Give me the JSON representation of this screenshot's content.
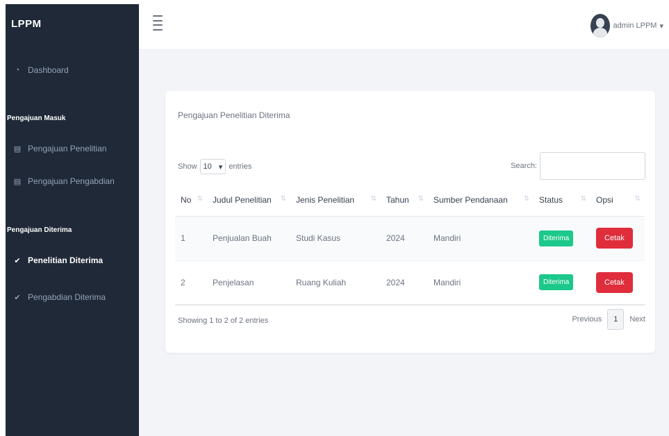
{
  "sidebar": {
    "brand": "LPPM",
    "dashboard": "Dashboard",
    "heading_masuk": "Pengajuan Masuk",
    "items_masuk": [
      "Pengajuan Penelitian",
      "Pengajuan Pengabdian"
    ],
    "heading_diterima": "Pengajuan Diterima",
    "items_diterima": [
      "Penelitian Diterima",
      "Pengabdian Diterima"
    ]
  },
  "topbar": {
    "user_name": "admin LPPM",
    "user_caret": "▾"
  },
  "card": {
    "title": "Pengajuan Penelitian Diterima",
    "show_label": "Show",
    "entries_value": "10",
    "entries_label": "entries",
    "search_label": "Search:",
    "columns": [
      "No",
      "Judul Penelitian",
      "Jenis Penelitian",
      "Tahun",
      "Sumber Pendanaan",
      "Status",
      "Opsi"
    ],
    "rows": [
      {
        "no": "1",
        "judul": "Penjualan Buah",
        "jenis": "Studi Kasus",
        "tahun": "2024",
        "sumber": "Mandiri",
        "status": "Diterima",
        "opsi": "Cetak"
      },
      {
        "no": "2",
        "judul": "Penjelasan",
        "jenis": "Ruang Kuliah",
        "tahun": "2024",
        "sumber": "Mandiri",
        "status": "Diterima",
        "opsi": "Cetak"
      }
    ],
    "info": "Showing 1 to 2 of 2 entries",
    "pager": {
      "previous": "Previous",
      "page": "1",
      "next": "Next"
    }
  },
  "colors": {
    "sidebar_bg": "#1f2937",
    "status_green": "#1cc88a",
    "cetak_red": "#e02d3c",
    "content_bg": "#f3f4f8"
  },
  "icons": {
    "dashboard": "gauge-icon",
    "pengajuan": "document-icon",
    "diterima": "check-icon",
    "hamburger": "menu-icon",
    "avatar": "user-avatar-icon"
  }
}
